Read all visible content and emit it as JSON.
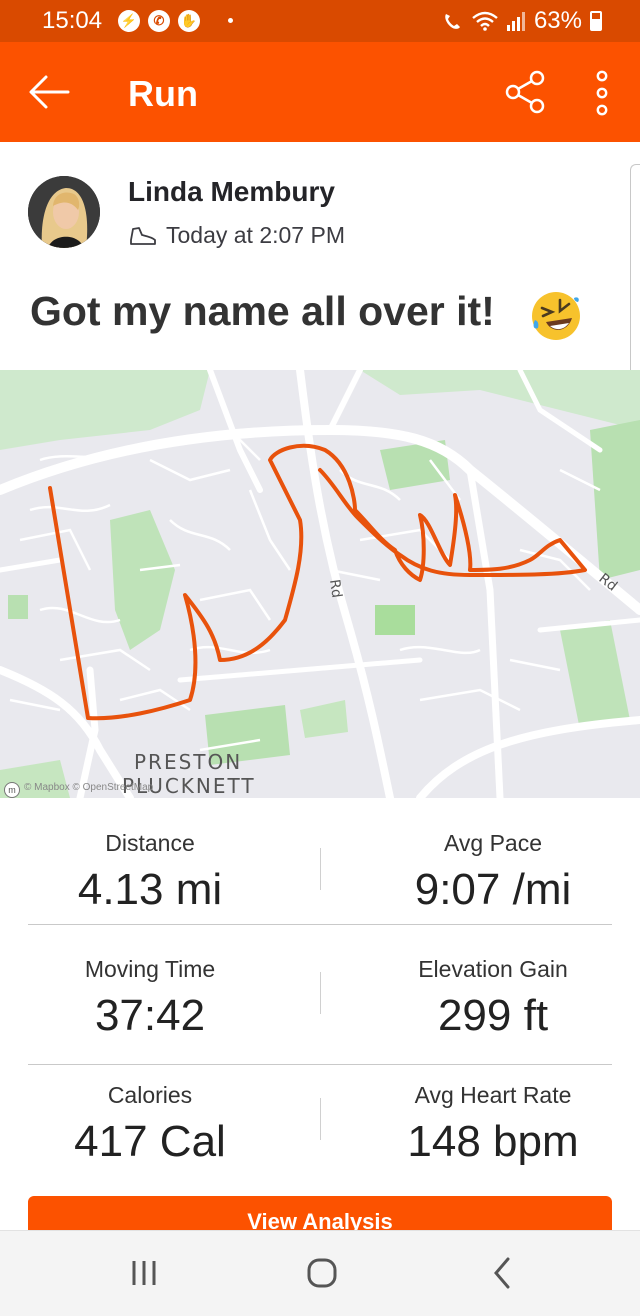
{
  "status_bar": {
    "time": "15:04",
    "battery": "63%",
    "icons": [
      "messenger-icon",
      "whatsapp-icon",
      "clap-icon",
      "wifi-calling-icon",
      "wifi-icon",
      "signal-icon",
      "battery-icon"
    ]
  },
  "app_bar": {
    "title": "Run",
    "icons": [
      "back-arrow-icon",
      "share-icon",
      "more-vertical-icon"
    ]
  },
  "activity": {
    "athlete_name": "Linda Membury",
    "timestamp": "Today at 2:07 PM",
    "title": "Got my name all over it!",
    "title_emoji": "rolling-on-floor-laughing"
  },
  "map": {
    "labels": {
      "area_line1": "PRESTON",
      "area_line2": "PLUCKNETT",
      "road1": "Rd",
      "road2": "Rd"
    },
    "attribution": "© Mapbox © OpenStreetMap",
    "route_color": "#fc5200"
  },
  "stats": [
    {
      "label": "Distance",
      "value": "4.13 mi"
    },
    {
      "label": "Avg Pace",
      "value": "9:07 /mi"
    },
    {
      "label": "Moving Time",
      "value": "37:42"
    },
    {
      "label": "Elevation Gain",
      "value": "299 ft"
    },
    {
      "label": "Calories",
      "value": "417 Cal"
    },
    {
      "label": "Avg Heart Rate",
      "value": "148 bpm"
    }
  ],
  "cta": {
    "label": "View Analysis"
  },
  "colors": {
    "brand": "#fc5200",
    "status_bar": "#d94a00"
  }
}
